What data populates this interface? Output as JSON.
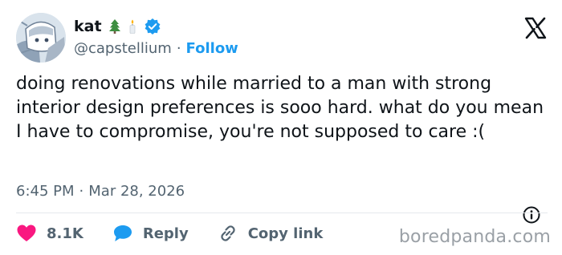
{
  "author": {
    "display_name": "kat",
    "emojis": [
      "evergreen-tree-emoji",
      "candle-emoji"
    ],
    "handle": "@capstellium",
    "separator": "·",
    "follow_label": "Follow"
  },
  "tweet": {
    "text": "doing renovations while married to a man with strong interior design preferences is sooo hard. what do you mean I have to compromise, you're not supposed to care :("
  },
  "meta": {
    "time": "6:45 PM",
    "separator": "·",
    "date": "Mar 28, 2026"
  },
  "actions": {
    "likes": "8.1K",
    "reply_label": "Reply",
    "copy_link_label": "Copy link"
  },
  "watermark": "boredpanda.com",
  "colors": {
    "accent": "#1d9bf0",
    "like": "#f91880",
    "text": "#0f1419",
    "secondary": "#536471"
  }
}
